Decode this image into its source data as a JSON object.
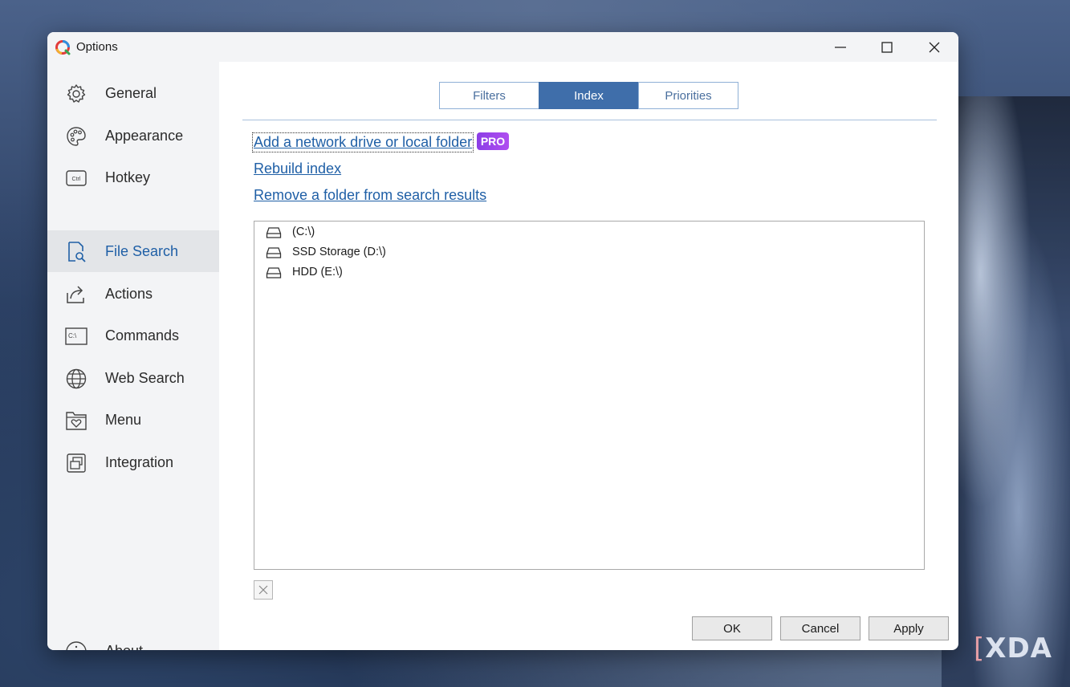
{
  "window": {
    "title": "Options"
  },
  "sidebar": {
    "items": [
      {
        "label": "General",
        "icon": "gear-icon"
      },
      {
        "label": "Appearance",
        "icon": "palette-icon"
      },
      {
        "label": "Hotkey",
        "icon": "keyboard-ctrl-icon",
        "icon_text": "Ctrl"
      },
      {
        "label": "File Search",
        "icon": "file-search-icon",
        "active": true
      },
      {
        "label": "Actions",
        "icon": "share-arrow-icon"
      },
      {
        "label": "Commands",
        "icon": "terminal-icon",
        "icon_text": "C:\\"
      },
      {
        "label": "Web Search",
        "icon": "globe-icon"
      },
      {
        "label": "Menu",
        "icon": "heart-folder-icon"
      },
      {
        "label": "Integration",
        "icon": "integration-icon"
      }
    ],
    "about": {
      "label": "About",
      "icon": "info-icon"
    }
  },
  "tabs": [
    {
      "label": "Filters"
    },
    {
      "label": "Index",
      "active": true
    },
    {
      "label": "Priorities"
    }
  ],
  "links": {
    "add_folder": "Add a network drive or local folder",
    "pro_badge": "PRO",
    "rebuild": "Rebuild index",
    "remove_folder": "Remove a folder from search results"
  },
  "drives": [
    {
      "label": " (C:\\)"
    },
    {
      "label": "SSD Storage (D:\\)"
    },
    {
      "label": "HDD (E:\\)"
    }
  ],
  "buttons": {
    "ok": "OK",
    "cancel": "Cancel",
    "apply": "Apply"
  },
  "watermark": "XDA",
  "colors": {
    "accent": "#3f6eaa",
    "link": "#1f5fa6",
    "pro_badge": "#9b45ea"
  }
}
